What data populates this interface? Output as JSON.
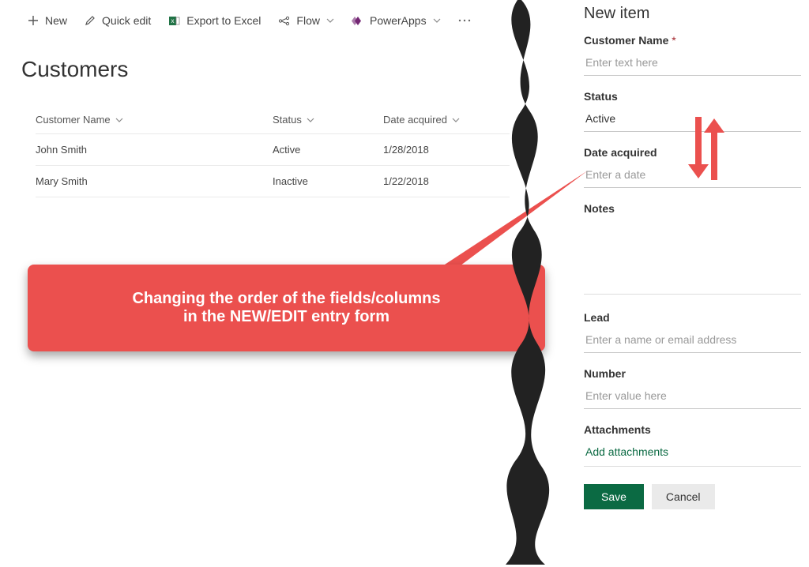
{
  "toolbar": {
    "new_label": "New",
    "quick_edit_label": "Quick edit",
    "export_label": "Export to Excel",
    "flow_label": "Flow",
    "powerapps_label": "PowerApps"
  },
  "page": {
    "title": "Customers"
  },
  "columns": {
    "name": "Customer Name",
    "status": "Status",
    "date": "Date acquired"
  },
  "rows": [
    {
      "name": "John Smith",
      "status": "Active",
      "date": "1/28/2018"
    },
    {
      "name": "Mary Smith",
      "status": "Inactive",
      "date": "1/22/2018"
    }
  ],
  "callout": {
    "line1": "Changing the order of the fields/columns",
    "line2": "in the NEW/EDIT entry form"
  },
  "panel": {
    "title": "New item",
    "fields": {
      "customer_name": {
        "label": "Customer Name",
        "placeholder": "Enter text here",
        "required": true
      },
      "status": {
        "label": "Status",
        "value": "Active"
      },
      "date_acquired": {
        "label": "Date acquired",
        "placeholder": "Enter a date"
      },
      "notes": {
        "label": "Notes"
      },
      "lead": {
        "label": "Lead",
        "placeholder": "Enter a name or email address"
      },
      "number": {
        "label": "Number",
        "placeholder": "Enter value here"
      },
      "attachments": {
        "label": "Attachments",
        "link": "Add attachments"
      }
    },
    "buttons": {
      "save": "Save",
      "cancel": "Cancel"
    }
  },
  "colors": {
    "accent_red": "#eb504e",
    "accent_green": "#0b6a43"
  }
}
